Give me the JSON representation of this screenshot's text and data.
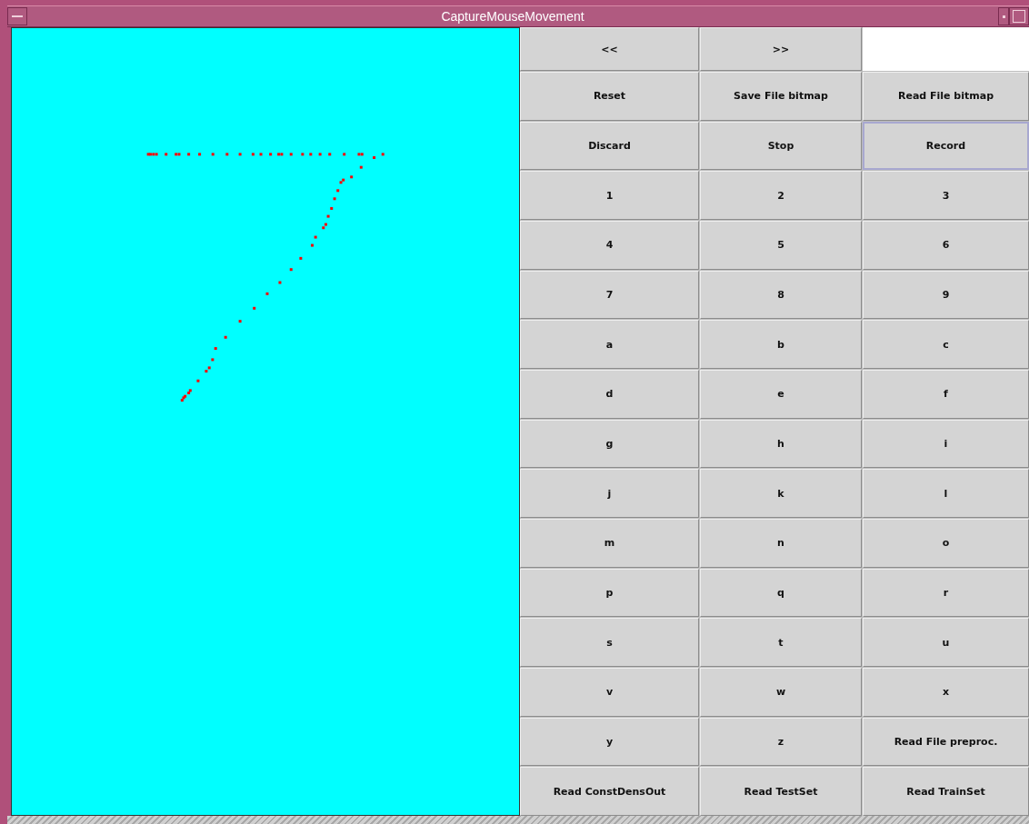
{
  "window": {
    "title": "CaptureMouseMovement"
  },
  "top_row": [
    {
      "label": "<<"
    },
    {
      "label": ">>"
    }
  ],
  "buttons": [
    {
      "label": "Reset",
      "focused": false
    },
    {
      "label": "Save File bitmap",
      "focused": false
    },
    {
      "label": "Read File bitmap",
      "focused": false
    },
    {
      "label": "Discard",
      "focused": false
    },
    {
      "label": "Stop",
      "focused": false
    },
    {
      "label": "Record",
      "focused": true
    },
    {
      "label": "1",
      "focused": false
    },
    {
      "label": "2",
      "focused": false
    },
    {
      "label": "3",
      "focused": false
    },
    {
      "label": "4",
      "focused": false
    },
    {
      "label": "5",
      "focused": false
    },
    {
      "label": "6",
      "focused": false
    },
    {
      "label": "7",
      "focused": false
    },
    {
      "label": "8",
      "focused": false
    },
    {
      "label": "9",
      "focused": false
    },
    {
      "label": "a",
      "focused": false
    },
    {
      "label": "b",
      "focused": false
    },
    {
      "label": "c",
      "focused": false
    },
    {
      "label": "d",
      "focused": false
    },
    {
      "label": "e",
      "focused": false
    },
    {
      "label": "f",
      "focused": false
    },
    {
      "label": "g",
      "focused": false
    },
    {
      "label": "h",
      "focused": false
    },
    {
      "label": "i",
      "focused": false
    },
    {
      "label": "j",
      "focused": false
    },
    {
      "label": "k",
      "focused": false
    },
    {
      "label": "l",
      "focused": false
    },
    {
      "label": "m",
      "focused": false
    },
    {
      "label": "n",
      "focused": false
    },
    {
      "label": "o",
      "focused": false
    },
    {
      "label": "p",
      "focused": false
    },
    {
      "label": "q",
      "focused": false
    },
    {
      "label": "r",
      "focused": false
    },
    {
      "label": "s",
      "focused": false
    },
    {
      "label": "t",
      "focused": false
    },
    {
      "label": "u",
      "focused": false
    },
    {
      "label": "v",
      "focused": false
    },
    {
      "label": "w",
      "focused": false
    },
    {
      "label": "x",
      "focused": false
    },
    {
      "label": "y",
      "focused": false
    },
    {
      "label": "z",
      "focused": false
    },
    {
      "label": "Read File preproc.",
      "focused": false
    },
    {
      "label": "Read ConstDensOut",
      "focused": false
    },
    {
      "label": "Read TestSet",
      "focused": false
    },
    {
      "label": "Read TrainSet",
      "focused": false
    }
  ]
}
